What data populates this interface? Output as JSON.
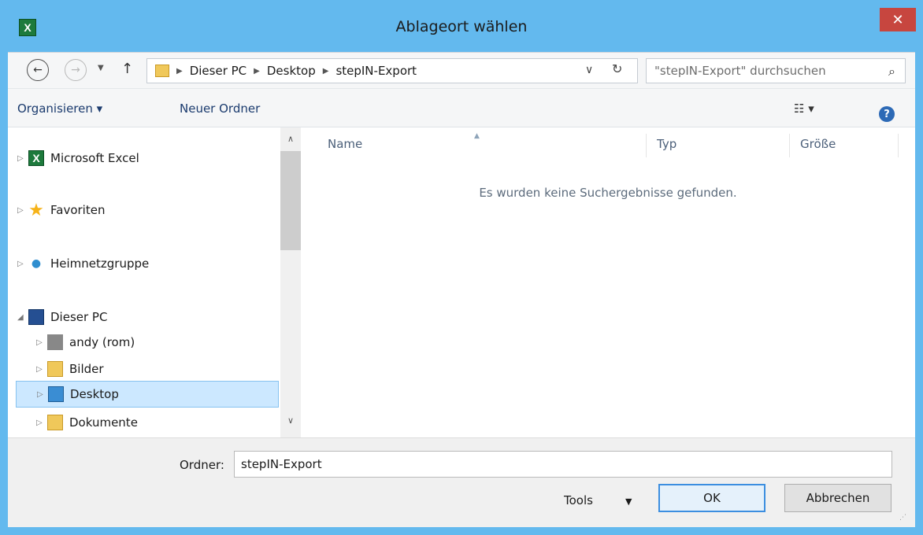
{
  "window": {
    "title": "Ablageort wählen",
    "close_glyph": "✕",
    "app_icon_letter": "X"
  },
  "nav": {
    "back_glyph": "←",
    "forward_glyph": "→",
    "recent_glyph": "▼",
    "up_glyph": "↑",
    "breadcrumb": [
      "Dieser PC",
      "Desktop",
      "stepIN-Export"
    ],
    "sep_glyph": "▶",
    "dropdown_glyph": "∨",
    "refresh_glyph": "↻",
    "search_placeholder": "\"stepIN-Export\" durchsuchen",
    "search_glyph": "⌕"
  },
  "toolbar": {
    "organize": "Organisieren ▾",
    "new_folder": "Neuer Ordner",
    "view_glyph": "☷ ▾",
    "help_glyph": "?"
  },
  "tree": {
    "expand_glyph": "▷",
    "expanded_glyph": "◢",
    "items": [
      {
        "label": "Microsoft Excel",
        "icon": "excel-icon"
      },
      {
        "label": "Favoriten",
        "icon": "star-icon"
      },
      {
        "label": "Heimnetzgruppe",
        "icon": "homegroup-icon"
      },
      {
        "label": "Dieser PC",
        "icon": "computer-icon"
      },
      {
        "label": "andy (rom)",
        "icon": "network-drive-icon"
      },
      {
        "label": "Bilder",
        "icon": "pictures-folder-icon"
      },
      {
        "label": "Desktop",
        "icon": "desktop-folder-icon"
      },
      {
        "label": "Dokumente",
        "icon": "documents-folder-icon"
      }
    ]
  },
  "scroll": {
    "up_glyph": "∧",
    "down_glyph": "∨"
  },
  "filelist": {
    "columns": [
      "Name",
      "Typ",
      "Größe"
    ],
    "sort_glyph": "▲",
    "empty_message": "Es wurden keine Suchergebnisse gefunden."
  },
  "footer": {
    "folder_label": "Ordner:",
    "folder_value": "stepIN-Export",
    "tools_label": "Tools",
    "tools_arrow": "▼",
    "ok_label": "OK",
    "cancel_label": "Abbrechen",
    "grip_glyph": "⋰"
  }
}
